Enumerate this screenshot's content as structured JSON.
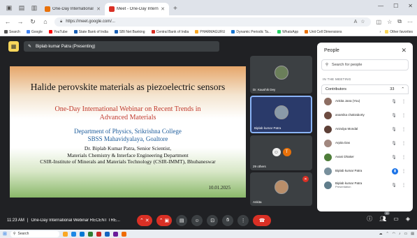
{
  "browser": {
    "tabs": [
      {
        "title": "One-Day International Webinar",
        "active": false
      },
      {
        "title": "Meet - One-Day International",
        "active": true
      }
    ],
    "url": "https://meet.google.com/...",
    "bookmarks": [
      "Search",
      "Google",
      "YouTube",
      "State Bank of India",
      "SBI Net Banking",
      "Central Bank of India",
      "PHARMAGURU",
      "Dynamic Periodic Ta...",
      "WhatsApp",
      "Unit Cell Dimensions"
    ],
    "bookmarks_right": "Other favorites"
  },
  "meet": {
    "presenting_label": "Biplab kumar Patra (Presenting)",
    "slide": {
      "title": "Halide perovskite materials as piezoelectric sensors",
      "webinar_line1": "One-Day International Webinar on Recent Trends in",
      "webinar_line2": "Advanced Materials",
      "dept_line1": "Department of Physics, Srikrishna College",
      "dept_line2": "SBSS Mahavidyalaya, Goaltore",
      "speaker_line1": "Dr. Biplab Kumar Patra, Senior Scientist,",
      "speaker_line2": "Materials Chemistry & Interface Engineering Department",
      "speaker_line3": "CSIR-Institute of Minerals and Materials Technology (CSIR-IMMT), Bhubaneswar",
      "date": "10.01.2025"
    },
    "tiles": [
      {
        "name": "Dr. Kaushik Dey"
      },
      {
        "name": "Biplab kumar Patra"
      },
      {
        "name": "29 others"
      },
      {
        "name": "Ankita"
      }
    ],
    "time": "11:23 AM",
    "meeting_name": "One-Day International Webinar RECENT TRE...",
    "participant_count_badge": "33"
  },
  "people": {
    "title": "People",
    "search_placeholder": "Search for people",
    "section_label": "IN THE MEETING",
    "group_label": "Contributors",
    "group_count": "33",
    "participants": [
      {
        "name": "Ankita Jana (You)",
        "sub": "",
        "color": "#8d6e63"
      },
      {
        "name": "anamika chakraborty",
        "sub": "",
        "color": "#6d4c41"
      },
      {
        "name": "Anindya Mondal",
        "sub": "",
        "color": "#5d4037"
      },
      {
        "name": "Arpita Das",
        "sub": "",
        "color": "#a1887f"
      },
      {
        "name": "Avani Dhaker",
        "sub": "",
        "color": "#4e7d3a"
      },
      {
        "name": "Biplab kumar Patra",
        "sub": "",
        "color": "#78909c"
      },
      {
        "name": "Biplab kumar Patra",
        "sub": "Presentation",
        "color": "#607d8b"
      }
    ]
  }
}
